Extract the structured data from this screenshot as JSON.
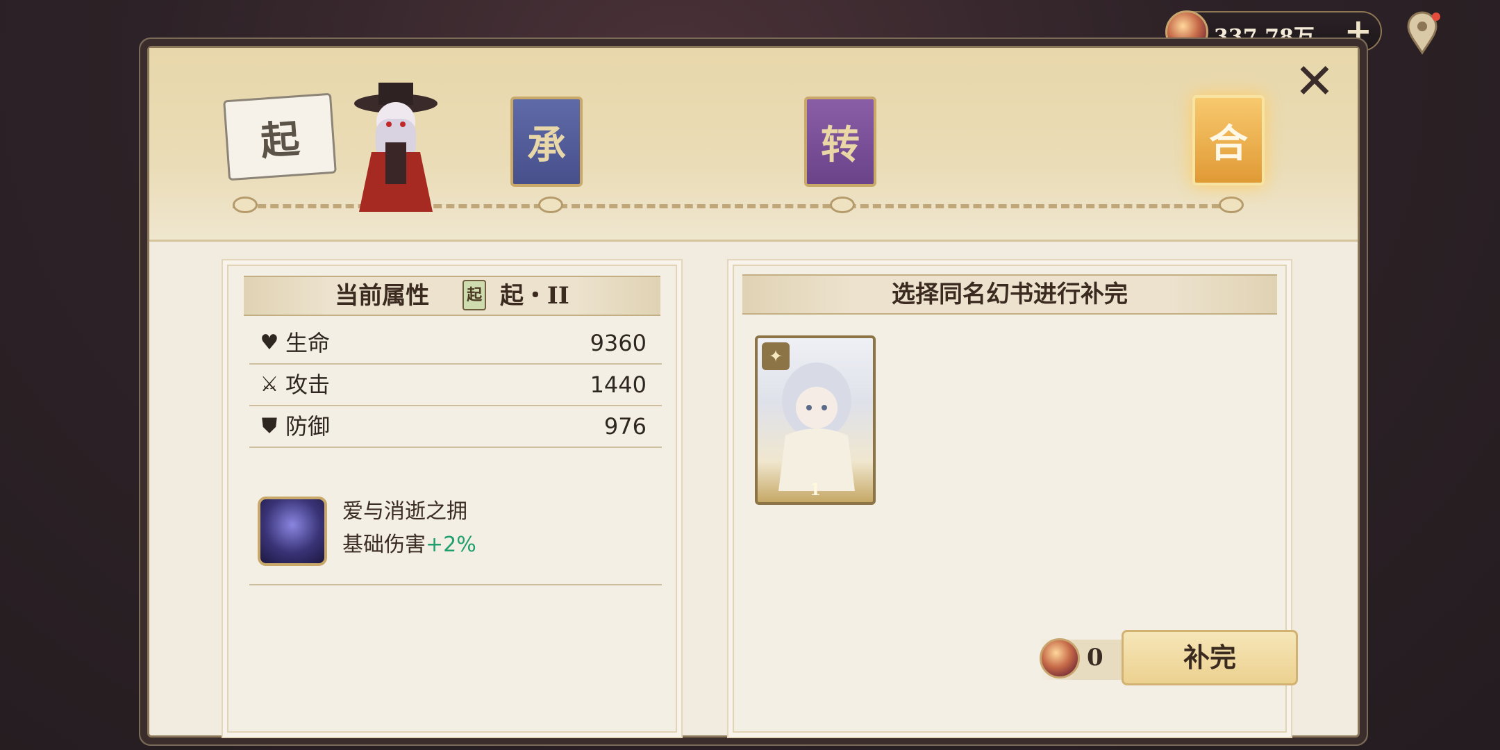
{
  "topbar": {
    "currency_amount": "337.78万",
    "add_label": "+",
    "coin_icon": "coin-icon",
    "map_icon": "map-pin-icon"
  },
  "progress": {
    "stages": [
      "起",
      "承",
      "转",
      "合"
    ],
    "close_label": "✕"
  },
  "attributes": {
    "title": "当前属性",
    "level_icon_text": "起",
    "level": "起・II",
    "stats": [
      {
        "icon": "heart-icon",
        "label": "生命",
        "value": "9360"
      },
      {
        "icon": "sword-icon",
        "label": "攻击",
        "value": "1440"
      },
      {
        "icon": "shield-icon",
        "label": "防御",
        "value": "976"
      }
    ],
    "skill": {
      "name": "爱与消逝之拥",
      "desc_prefix": "基础伤害",
      "desc_bonus": "+2%"
    }
  },
  "select": {
    "title": "选择同名幻书进行补完",
    "card_count": "1",
    "cost_value": "0",
    "confirm_label": "补完"
  },
  "colors": {
    "accent_gold": "#c9a96a",
    "bonus_green": "#1f9e6e",
    "panel_bg": "#f2ece0"
  }
}
